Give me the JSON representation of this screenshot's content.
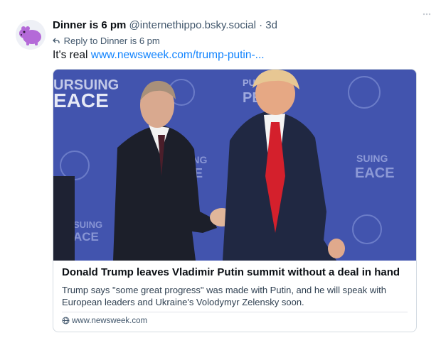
{
  "post": {
    "author_name": "Dinner is 6 pm",
    "author_handle": "@internethippo.bsky.social",
    "separator": "·",
    "age": "3d",
    "reply_to": "Reply to Dinner is 6 pm",
    "text": "It's real",
    "link_text": "www.newsweek.com/trump-putin-...",
    "avatar_icon": "hippo-avatar-icon",
    "reply_icon": "reply-arrow-icon",
    "more_icon": "more-options-icon"
  },
  "card": {
    "image_signs": [
      "URSUING",
      "EACE",
      "SUING",
      "ACE",
      "SUING",
      "EACE",
      "SUING",
      "ACE",
      "PU",
      "PE"
    ],
    "title": "Donald Trump leaves Vladimir Putin summit without a deal in hand",
    "description": "Trump says \"some great progress\" was made with Putin, and he will speak with European leaders and Ukraine's Volodymyr Zelensky soon.",
    "domain": "www.newsweek.com",
    "domain_icon": "globe-icon"
  },
  "colors": {
    "link": "#1083fe",
    "muted": "#42576c",
    "backdrop": "#3f52a9",
    "avatar_purple": "#b46ad8"
  }
}
